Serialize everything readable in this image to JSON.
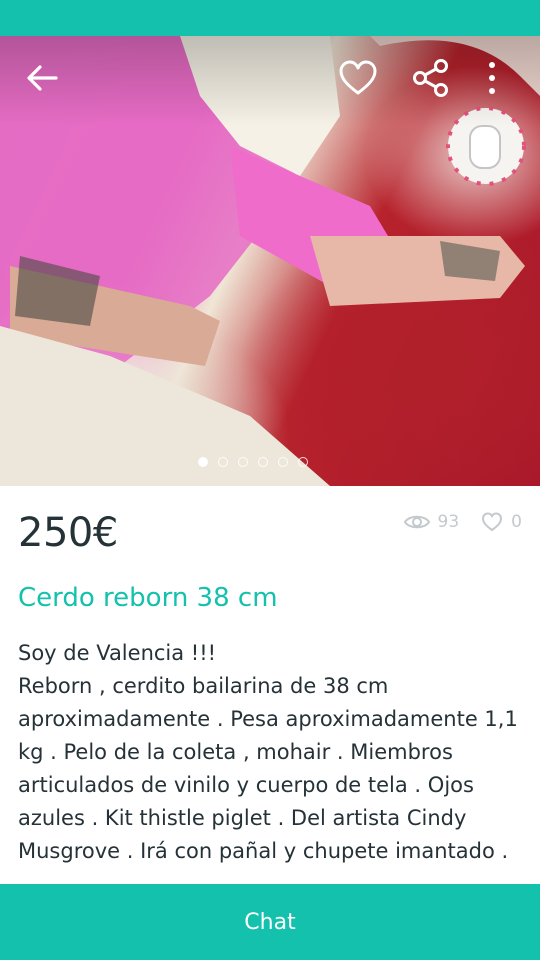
{
  "listing": {
    "price": "250€",
    "title": "Cerdo reborn 38 cm",
    "views": "93",
    "favorites": "0",
    "description": [
      "Soy de Valencia !!!",
      "Reborn , cerdito bailarina de 38 cm aproximadamente . Pesa aproximadamente 1,1 kg . Pelo de la coleta , mohair . Miembros articulados de vinilo y cuerpo de tela . Ojos azules . Kit thistle piglet . Del artista Cindy Musgrove . Irá con pañal y chupete imantado ."
    ]
  },
  "gallery": {
    "photo_count": 6,
    "active_photo": 1
  },
  "icons": {
    "back": "arrow-left-icon",
    "favorite": "heart-outline-icon",
    "share": "share-icon",
    "more": "more-vertical-icon",
    "views": "eye-icon",
    "favorites": "heart-outline-icon"
  },
  "actions": {
    "chat_label": "Chat"
  },
  "colors": {
    "brand": "#13c1ac",
    "text": "#253238",
    "muted": "#c3c9cc",
    "background": "#ffffff"
  }
}
